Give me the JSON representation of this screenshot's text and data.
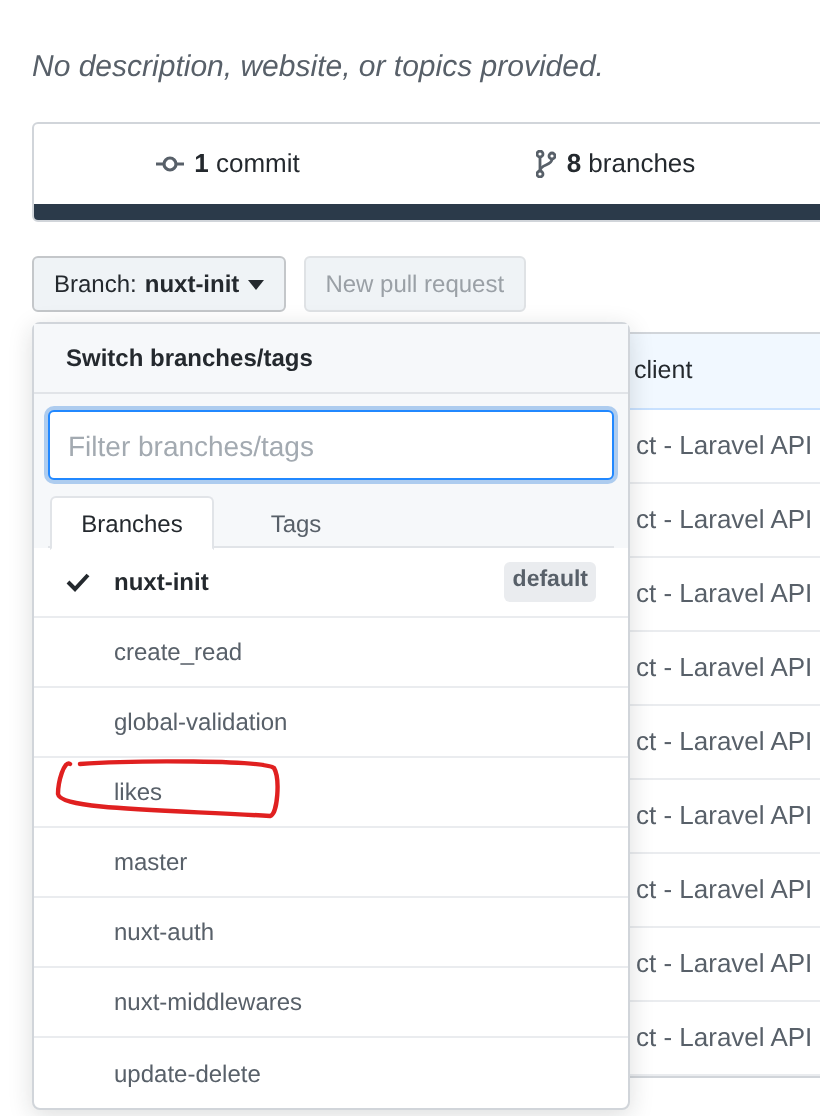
{
  "description": "No description, website, or topics provided.",
  "stats": [
    {
      "kind": "commits",
      "count": "1",
      "label": "commit"
    },
    {
      "kind": "branches",
      "count": "8",
      "label": "branches"
    }
  ],
  "branch_button": {
    "prefix": "Branch:",
    "value": "nuxt-init"
  },
  "pull_request_button": {
    "label": "New pull request",
    "disabled": true
  },
  "file_table": {
    "header": "client",
    "rows": [
      {
        "message": "ct - Laravel API"
      },
      {
        "message": "ct - Laravel API"
      },
      {
        "message": "ct - Laravel API"
      },
      {
        "message": "ct - Laravel API"
      },
      {
        "message": "ct - Laravel API"
      },
      {
        "message": "ct - Laravel API"
      },
      {
        "message": "ct - Laravel API"
      },
      {
        "message": "ct - Laravel API"
      },
      {
        "message": "ct - Laravel API"
      }
    ]
  },
  "dropdown": {
    "title": "Switch branches/tags",
    "filter": {
      "placeholder": "Filter branches/tags"
    },
    "tabs": [
      {
        "label": "Branches",
        "selected": true
      },
      {
        "label": "Tags",
        "selected": false
      }
    ],
    "branches": [
      {
        "name": "nuxt-init",
        "selected": true,
        "badge": "default",
        "circled": false
      },
      {
        "name": "create_read",
        "selected": false,
        "circled": false
      },
      {
        "name": "global-validation",
        "selected": false,
        "circled": false
      },
      {
        "name": "likes",
        "selected": false,
        "circled": true
      },
      {
        "name": "master",
        "selected": false,
        "circled": false
      },
      {
        "name": "nuxt-auth",
        "selected": false,
        "circled": false
      },
      {
        "name": "nuxt-middlewares",
        "selected": false,
        "circled": false
      },
      {
        "name": "update-delete",
        "selected": false,
        "circled": false
      }
    ]
  }
}
